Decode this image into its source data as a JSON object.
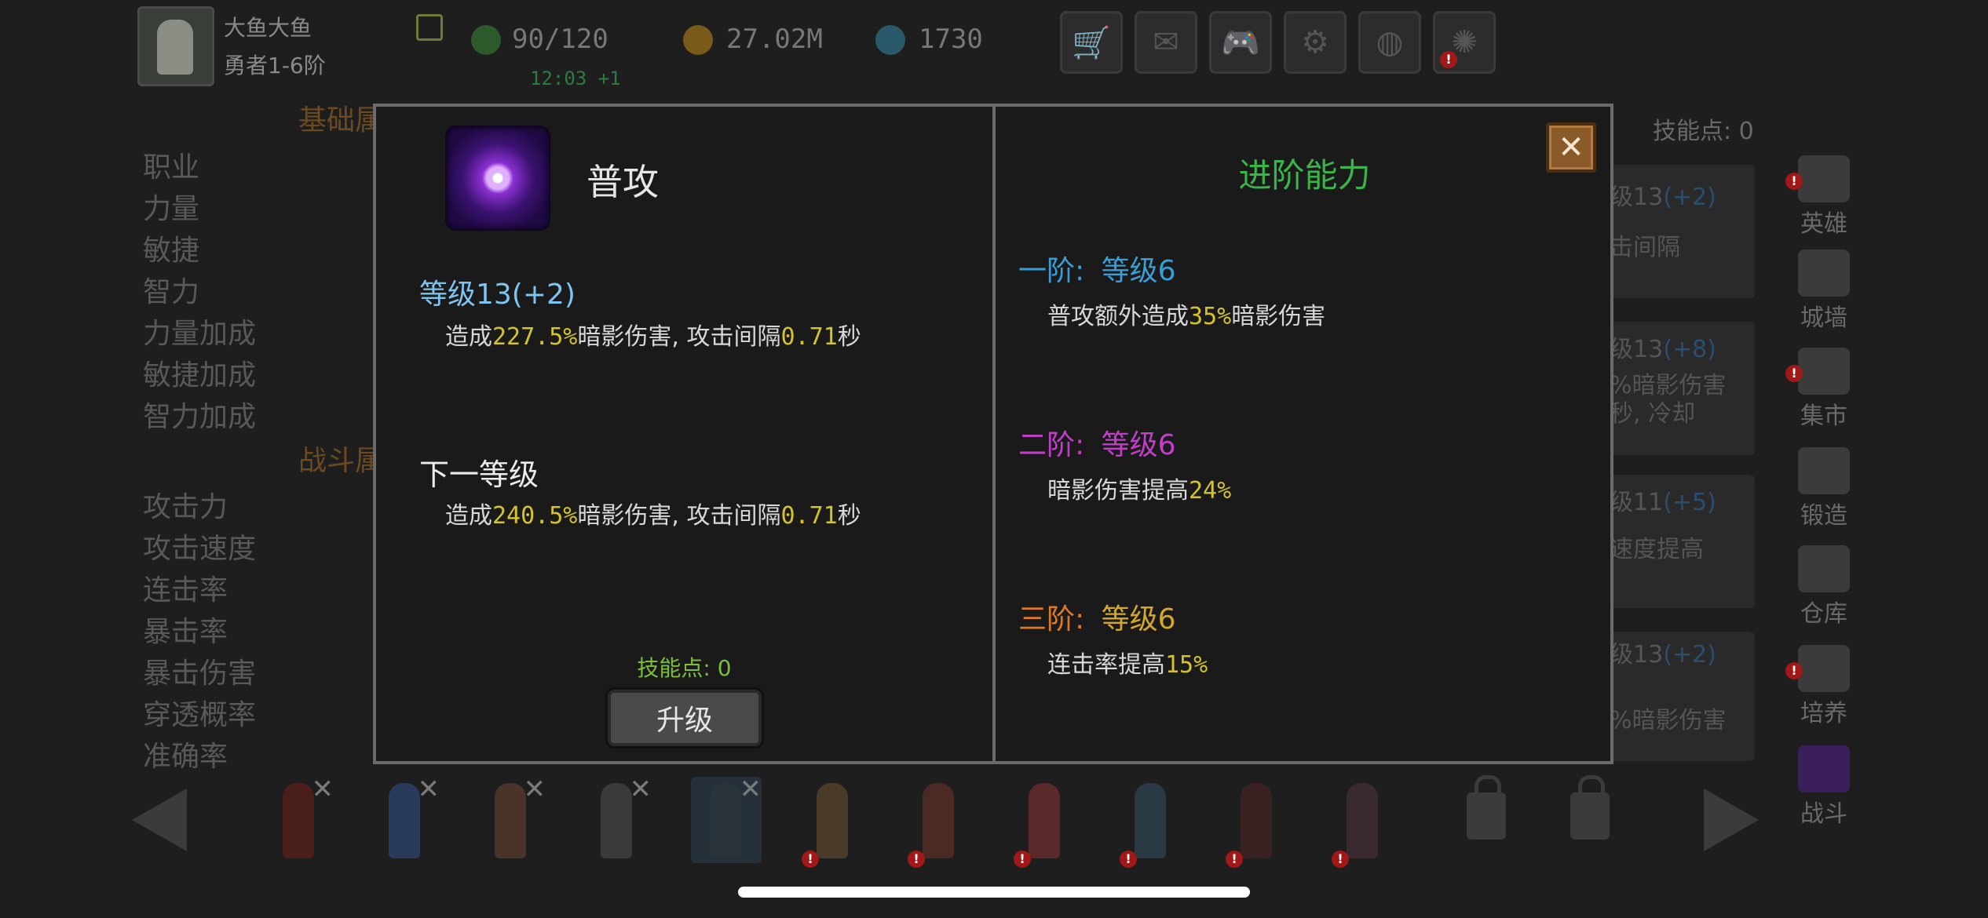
{
  "player": {
    "name": "大鱼大鱼",
    "rank": "勇者1-6阶"
  },
  "resources": {
    "energy": "90/120",
    "gold": "27.02M",
    "gems": "1730",
    "timer": "12:03 +1"
  },
  "top_buttons": [
    "cart-icon",
    "mail-icon",
    "gamepad-icon",
    "gear-icon",
    "color-wheel-icon",
    "firework-icon"
  ],
  "background": {
    "section_basic": "基础属",
    "section_battle": "战斗属",
    "basic_stats": [
      "职业",
      "力量",
      "敏捷",
      "智力",
      "力量加成",
      "敏捷加成",
      "智力加成"
    ],
    "battle_stats": [
      "攻击力",
      "攻击速度",
      "连击率",
      "暴击率",
      "暴击伤害",
      "穿透概率",
      "准确率"
    ],
    "skill_points": "技能点: 0",
    "cards": [
      {
        "lvl": "级13",
        "bonus": "(+2)",
        "line1": "击间隔",
        "line2": ""
      },
      {
        "lvl": "级13",
        "bonus": "(+8)",
        "line1": "%暗影伤害",
        "line2": "秒, 冷却"
      },
      {
        "lvl": "级11",
        "bonus": "(+5)",
        "line1": "速度提高",
        "line2": ""
      },
      {
        "lvl": "级13",
        "bonus": "(+2)",
        "line1": "",
        "line2": "%暗影伤害"
      }
    ],
    "side_menu": [
      "英雄",
      "城墙",
      "集市",
      "锻造",
      "仓库",
      "培养",
      "战斗"
    ]
  },
  "modal": {
    "skill_name": "普攻",
    "level_label": "等级13(+2)",
    "current": {
      "pre": "造成",
      "dmg": "227.5%",
      "mid": "暗影伤害, 攻击间隔",
      "interval": "0.71",
      "post": "秒"
    },
    "next_title": "下一等级",
    "next": {
      "pre": "造成",
      "dmg": "240.5%",
      "mid": "暗影伤害, 攻击间隔",
      "interval": "0.71",
      "post": "秒"
    },
    "skill_points": "技能点: 0",
    "upgrade_label": "升级",
    "advanced_title": "进阶能力",
    "tiers": [
      {
        "name": "一阶:",
        "req": "等级6",
        "color": "#3a9ed6",
        "pre": "普攻额外造成",
        "value": "35%",
        "post": "暗影伤害"
      },
      {
        "name": "二阶:",
        "req": "等级6",
        "color": "#c23ec9",
        "pre": "暗影伤害提高",
        "value": "24%",
        "post": ""
      },
      {
        "name": "三阶:",
        "req": "等级6",
        "color": "#e07a22",
        "pre": "连击率提高",
        "value": "15%",
        "post": ""
      }
    ],
    "req_color": "#d4a82a",
    "close_symbol": "✕"
  }
}
